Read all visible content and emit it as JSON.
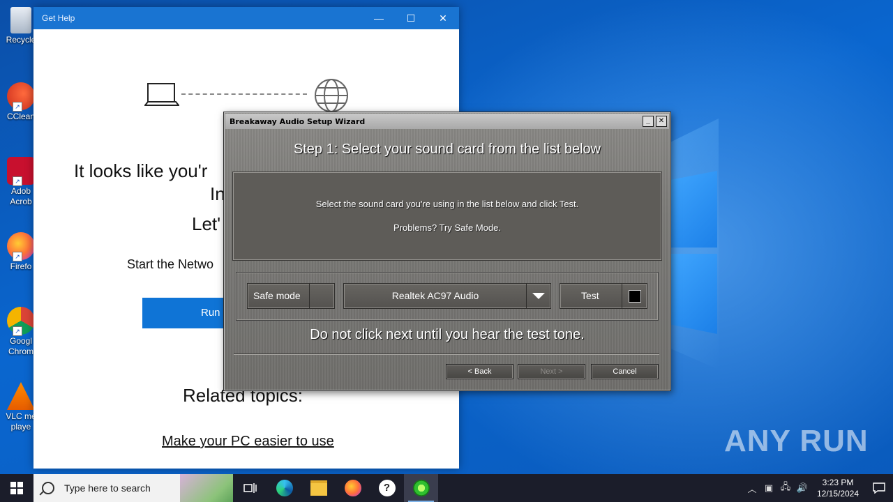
{
  "desktop": {
    "icons": [
      {
        "label": "Recycle",
        "icon": "recycle-bin-icon"
      },
      {
        "label": "CClean",
        "icon": "ccleaner-icon"
      },
      {
        "label": "Adob Acrob",
        "icon": "adobe-acrobat-icon"
      },
      {
        "label": "Firefo",
        "icon": "firefox-icon"
      },
      {
        "label": "Googl Chrom",
        "icon": "chrome-icon"
      },
      {
        "label": "VLC me playe",
        "icon": "vlc-icon"
      }
    ],
    "watermark": "ANY RUN"
  },
  "gethelp": {
    "title": "Get Help",
    "heading_line1": "It looks like you'r",
    "heading_line2": "In",
    "heading_line3": "Let'",
    "subtext": "Start the Netwo",
    "run_button": "Run",
    "related_title": "Related topics:",
    "related_link": "Make your PC easier to use"
  },
  "wizard": {
    "title": "Breakaway Audio Setup Wizard",
    "step": "Step 1: Select your sound card from the list below",
    "instruction": "Select the sound card you're using in the list below and click Test.",
    "problems": "Problems? Try Safe Mode.",
    "safe_mode_label": "Safe mode",
    "selected_card": "Realtek AC97 Audio",
    "test_label": "Test",
    "warning": "Do not click next until you hear the test tone.",
    "back_label": "< Back",
    "next_label": "Next >",
    "cancel_label": "Cancel"
  },
  "taskbar": {
    "search_placeholder": "Type here to search",
    "time": "3:23 PM",
    "date": "12/15/2024"
  },
  "colors": {
    "taskbar": "#1b1d2a",
    "gethelp_titlebar": "#1974d2",
    "run_button": "#0f74d6",
    "wizard_body": "#7a7976"
  }
}
